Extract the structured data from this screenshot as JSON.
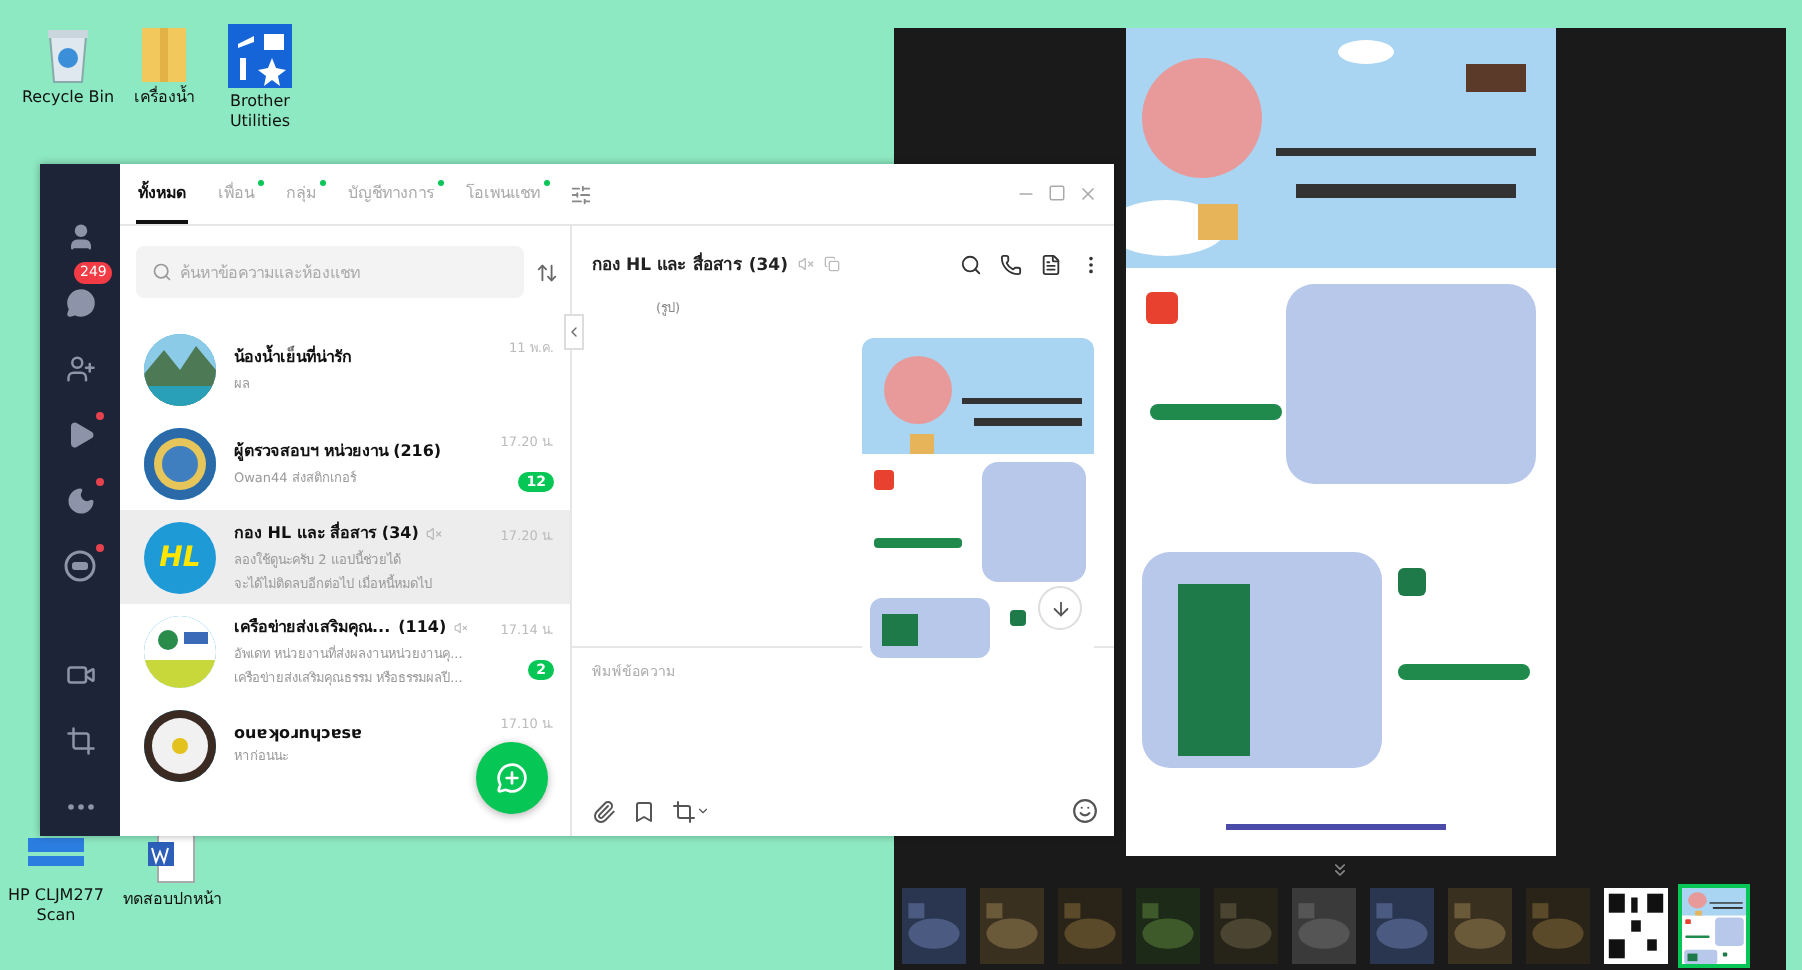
{
  "desktop": {
    "top_icons": [
      {
        "label": "Recycle Bin",
        "kind": "recycle"
      },
      {
        "label": "เครื่องน้ำ",
        "kind": "folder"
      },
      {
        "label": "Brother Utilities",
        "kind": "tools"
      }
    ],
    "bottom_icons": [
      {
        "label": "HP CLJM277 Scan",
        "kind": "scanner"
      },
      {
        "label": "ทดสอบปกหน้า",
        "kind": "document"
      }
    ]
  },
  "chat_window": {
    "nav": [
      {
        "kind": "friends",
        "dot": false
      },
      {
        "kind": "chats",
        "dot": false,
        "badge": "249"
      },
      {
        "kind": "add-friend",
        "dot": false
      },
      {
        "kind": "voom",
        "dot": true
      },
      {
        "kind": "moon",
        "dot": true
      },
      {
        "kind": "line",
        "dot": true
      },
      {
        "kind": "video",
        "dot": false
      },
      {
        "kind": "crop",
        "dot": false
      },
      {
        "kind": "more",
        "dot": false
      }
    ],
    "tabs": [
      {
        "label": "ทั้งหมด",
        "selected": true,
        "dot": false
      },
      {
        "label": "เพื่อน",
        "selected": false,
        "dot": true
      },
      {
        "label": "กลุ่ม",
        "selected": false,
        "dot": true
      },
      {
        "label": "บัญชีทางการ",
        "selected": false,
        "dot": true
      },
      {
        "label": "โอเพนแชท",
        "selected": false,
        "dot": true
      }
    ],
    "search": {
      "placeholder": "ค้นหาข้อความและห้องแชท"
    },
    "chats": [
      {
        "name": "น้องน้ำเย็นที่น่ารัก",
        "preview": [
          "ผล"
        ],
        "time": "11 พ.ค.",
        "muted": false,
        "selected": false
      },
      {
        "name": "ผู้ตรวจสอบฯ หน่วยงาน (216)",
        "preview": [
          "Owan44 ส่งสติกเกอร์"
        ],
        "time": "17.20 น.",
        "unread": "12",
        "muted": false,
        "selected": false
      },
      {
        "name": "กอง HL และ สื่อสาร (34)",
        "preview": [
          "ลองใช้ดูนะครับ 2 แอปนี้ช่วยได้",
          "จะได้ไม่ติดลบอีกต่อไป เมื่อหนี้หมดไป"
        ],
        "time": "17.20 น.",
        "muted": true,
        "selected": true,
        "avatar_text": "HL"
      },
      {
        "name": "เครือข่ายส่งเสริมคุณ...",
        "count": "(114)",
        "preview": [
          "อัพเดท หน่วยงานที่ส่งผลงานหน่วยงานคุ...",
          "เครือข่ายส่งเสริมคุณธรรม หรือธรรมผลปี..."
        ],
        "time": "17.14 น.",
        "unread": "2",
        "muted": true,
        "selected": false
      },
      {
        "name": "ouɐʞoɹnɥɔɐsɐ",
        "preview": [
          "หาก่อนนะ"
        ],
        "time": "17.10 น.",
        "muted": false,
        "selected": false
      }
    ],
    "conversation": {
      "title": "กอง HL และ สื่อสาร (34)",
      "muted": true,
      "image_caption": "(รูป)",
      "input": {
        "placeholder": "พิมพ์ข้อความ"
      }
    }
  },
  "viewer": {
    "thumbnails": [
      {
        "kind": "picture",
        "selected": false
      },
      {
        "kind": "picture",
        "selected": false
      },
      {
        "kind": "picture",
        "selected": false
      },
      {
        "kind": "picture",
        "selected": false
      },
      {
        "kind": "picture",
        "selected": false
      },
      {
        "kind": "picture",
        "selected": false
      },
      {
        "kind": "picture",
        "selected": false
      },
      {
        "kind": "picture",
        "selected": false
      },
      {
        "kind": "picture",
        "selected": false
      },
      {
        "kind": "qr",
        "selected": false
      },
      {
        "kind": "picture",
        "selected": true
      }
    ]
  }
}
